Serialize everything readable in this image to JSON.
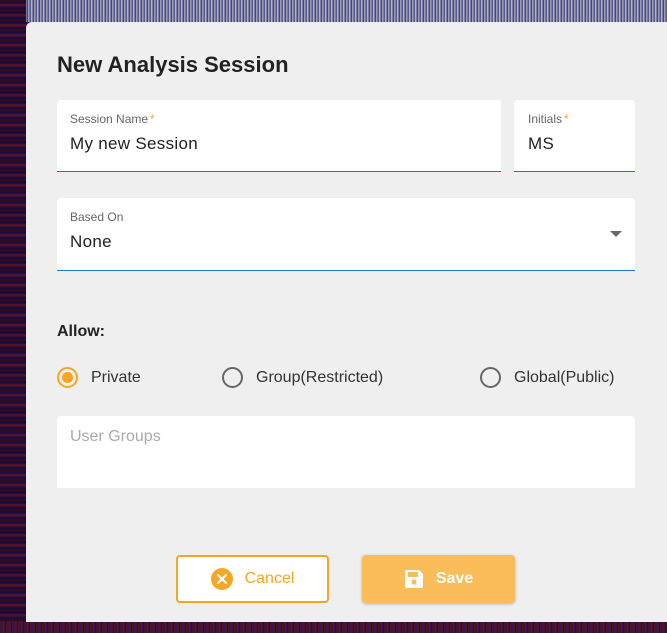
{
  "dialog": {
    "title": "New Analysis Session",
    "session_name": {
      "label": "Session Name",
      "required_mark": "*",
      "value": "My new Session"
    },
    "initials": {
      "label": "Initials",
      "required_mark": "*",
      "value": "MS"
    },
    "based_on": {
      "label": "Based On",
      "value": "None"
    },
    "allow": {
      "label": "Allow:",
      "options": [
        {
          "label": "Private",
          "checked": true
        },
        {
          "label": "Group(Restricted)",
          "checked": false
        },
        {
          "label": "Global(Public)",
          "checked": false
        }
      ]
    },
    "user_groups": {
      "placeholder": "User Groups"
    },
    "buttons": {
      "cancel": "Cancel",
      "save": "Save"
    }
  },
  "colors": {
    "accent": "#f5a623",
    "field_underline": "#1976d2",
    "dialog_bg": "#efefef"
  },
  "icons": {
    "cancel": "cancel-circle-icon",
    "save": "save-floppy-icon",
    "dropdown": "dropdown-arrow-icon"
  }
}
